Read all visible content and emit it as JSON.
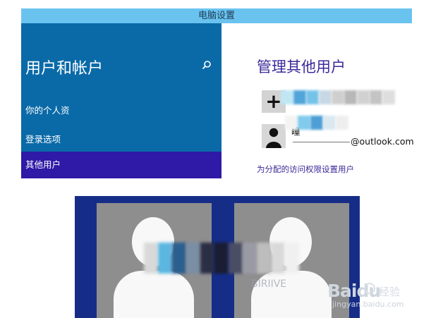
{
  "window": {
    "title": "电脑设置"
  },
  "sidebar": {
    "title": "用户和帐户",
    "items": [
      {
        "label": "你的个人资"
      },
      {
        "label": "登录选项"
      },
      {
        "label": "其他用户"
      }
    ]
  },
  "main": {
    "title": "管理其他用户",
    "add_user_label": "+",
    "user": {
      "name_partial": "瞳",
      "email_domain": "@outlook.com"
    },
    "assigned_access_link": "为分配的访问权限设置用户"
  },
  "photo": {
    "ghost_text": "BIRIIVE"
  },
  "watermark": {
    "logo": "Baidu",
    "cn": "经验",
    "url": "jingyan.baidu.com"
  },
  "colors": {
    "topbar": "#6ac3ef",
    "sidebar": "#0a6aa8",
    "selected": "#2e1aa6",
    "accent_text": "#3b2a9b"
  }
}
